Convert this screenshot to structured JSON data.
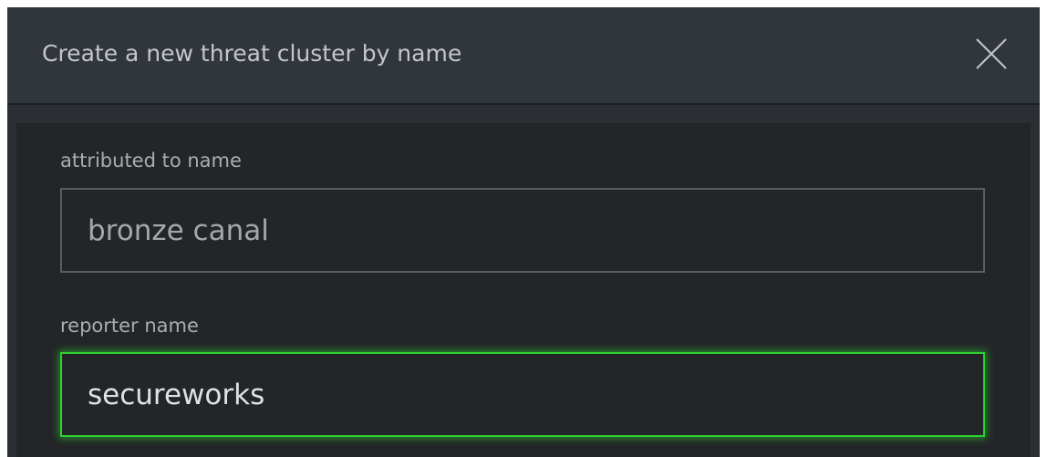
{
  "dialog": {
    "title": "Create a new threat cluster by name",
    "close_icon": "close-icon"
  },
  "form": {
    "attributed_to": {
      "label": "attributed to name",
      "value": "bronze canal"
    },
    "reporter": {
      "label": "reporter name",
      "value": "secureworks",
      "focused": true
    }
  },
  "colors": {
    "focus_accent": "#2ed12e",
    "header_bg": "#31363a",
    "body_bg": "#242529"
  }
}
